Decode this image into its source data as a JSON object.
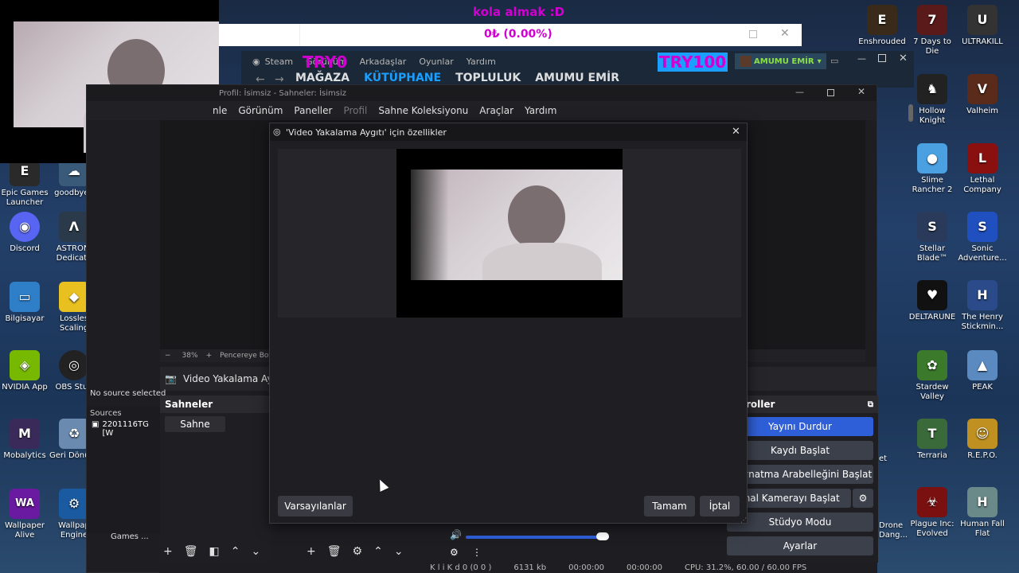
{
  "overlay": {
    "donation_message": "kola almak :D",
    "donation_amount": "0₺ (0.00%)",
    "try_left": "TRY0",
    "try_right": "TRY100"
  },
  "steam": {
    "brand": "Steam",
    "menu": [
      "Görünüm",
      "Arkadaşlar",
      "Oyunlar",
      "Yardım"
    ],
    "nav": [
      "MAĞAZA",
      "KÜTÜPHANE",
      "TOPLULUK",
      "AMUMU EMİR"
    ],
    "user": "AMUMU EMİR",
    "accent": "#1a9fff"
  },
  "obs": {
    "window_title": "Profil: İsimsiz - Sahneler: İsimsiz",
    "menu": [
      "nle",
      "Görünüm",
      "Paneller",
      "Profil",
      "Sahne Koleksiyonu",
      "Araçlar",
      "Yardım"
    ],
    "zoom": "38%",
    "fit_label": "Pencereye Boy",
    "source_toolbar_label": "Video Yakalama Aygıtı",
    "no_source": "No source selected",
    "sources_header": "Sources",
    "source_item": "2201116TG [W",
    "scenes_header": "Sahneler",
    "scene_item": "Sahne",
    "controls_header": "roller",
    "controls": {
      "stop_stream": "Yayını Durdur",
      "start_record": "Kaydı Başlat",
      "replay_buffer": "r Oynatma Arabelleğini Başlat",
      "virtual_cam": "anal Kamerayı Başlat",
      "studio_mode": "Stüdyo Modu",
      "settings": "Ayarlar"
    },
    "stream_button_color": "#2f5fd8",
    "status": {
      "left": "K     l i     K     d  0 (0 0 )",
      "bitrate": "6131 kb",
      "time1": "00:00:00",
      "time2": "00:00:00",
      "cpu": "CPU: 31.2%, 60.00 / 60.00 FPS"
    }
  },
  "dialog": {
    "title": "'Video Yakalama Aygıtı' için özellikler",
    "defaults_label": "Varsayılanlar",
    "ok_label": "Tamam",
    "cancel_label": "İptal"
  },
  "desktop": {
    "left": [
      {
        "label": "Epic Games Launcher",
        "color": "#2a2a2a",
        "glyph": "E"
      },
      {
        "label": "goodbyeq",
        "color": "#3a5a7a",
        "glyph": "☁"
      },
      {
        "label": "Discord",
        "color": "#5865f2",
        "glyph": "◉"
      },
      {
        "label": "ASTRONI Dedicate",
        "color": "#2a3a4a",
        "glyph": "Λ"
      },
      {
        "label": "Bilgisayar",
        "color": "#2f7fc8",
        "glyph": "▭"
      },
      {
        "label": "Lossles Scaling",
        "color": "#e8c020",
        "glyph": "◆"
      },
      {
        "label": "NVIDIA App",
        "color": "#76b900",
        "glyph": "◈"
      },
      {
        "label": "OBS Stud",
        "color": "#222",
        "glyph": "◎"
      },
      {
        "label": "Mobalytics",
        "color": "#3a2a5a",
        "glyph": "M"
      },
      {
        "label": "Geri Dönüşü",
        "color": "#6a8ab0",
        "glyph": "♻"
      },
      {
        "label": "Wallpaper Alive",
        "color": "#6a1aa0",
        "glyph": "WA"
      },
      {
        "label": "Wallpap Engine",
        "color": "#1a5aa0",
        "glyph": "⚙"
      },
      {
        "label": "Games ...",
        "color": "transparent",
        "glyph": ""
      }
    ],
    "right": [
      {
        "label": "Enshrouded",
        "color": "#3a2a1a",
        "glyph": "E"
      },
      {
        "label": "7 Days to Die",
        "color": "#5a1a1a",
        "glyph": "7"
      },
      {
        "label": "ULTRAKILL",
        "color": "#333",
        "glyph": "U"
      },
      {
        "label": "Hollow Knight",
        "color": "#222",
        "glyph": "♞"
      },
      {
        "label": "Valheim",
        "color": "#5a2a1a",
        "glyph": "V"
      },
      {
        "label": "Slime Rancher 2",
        "color": "#4aa0e0",
        "glyph": "●"
      },
      {
        "label": "Lethal Company",
        "color": "#8a1010",
        "glyph": "L"
      },
      {
        "label": "Stellar Blade™",
        "color": "#2a3a5a",
        "glyph": "S"
      },
      {
        "label": "Sonic Adventure...",
        "color": "#2050c0",
        "glyph": "S"
      },
      {
        "label": "DELTARUNE",
        "color": "#111",
        "glyph": "♥"
      },
      {
        "label": "The Henry Stickmin...",
        "color": "#2a4a8a",
        "glyph": "H"
      },
      {
        "label": "Stardew Valley",
        "color": "#3a7a2a",
        "glyph": "✿"
      },
      {
        "label": "PEAK",
        "color": "#5a8ac0",
        "glyph": "▲"
      },
      {
        "label": "Terraria",
        "color": "#3a6a3a",
        "glyph": "T"
      },
      {
        "label": "R.E.P.O.",
        "color": "#c09020",
        "glyph": "☺"
      },
      {
        "label": "Plague Inc: Evolved",
        "color": "#7a1010",
        "glyph": "☣"
      },
      {
        "label": "Human Fall Flat",
        "color": "#6a8a8a",
        "glyph": "H"
      }
    ],
    "partial_right_labels": [
      "Drone Dang...",
      "et"
    ]
  }
}
